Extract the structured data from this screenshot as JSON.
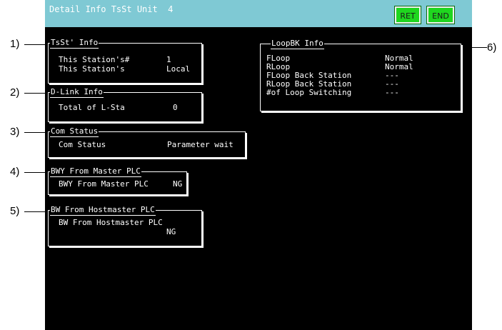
{
  "window": {
    "title": "Detail Info TsSt Unit  4"
  },
  "buttons": {
    "ret": "RET",
    "end": "END"
  },
  "callouts": [
    "1)",
    "2)",
    "3)",
    "4)",
    "5)",
    "6)"
  ],
  "tsst_info": {
    "title": "TsSt' Info",
    "rows": [
      {
        "label": "This Station's#",
        "value": "1"
      },
      {
        "label": "This Station's",
        "value": "Local"
      }
    ]
  },
  "dlink_info": {
    "title": "D-Link Info",
    "rows": [
      {
        "label": "Total of L-Sta",
        "value": "0"
      }
    ]
  },
  "com_status": {
    "title": "Com Status",
    "rows": [
      {
        "label": "Com Status",
        "value": "Parameter wait"
      }
    ]
  },
  "bwy_master": {
    "title": "BWY From Master PLC",
    "rows": [
      {
        "label": "BWY From Master PLC",
        "value": "NG"
      }
    ]
  },
  "bw_hostmaster": {
    "title": "BW From Hostmaster PLC",
    "label": "BW From Hostmaster PLC",
    "value": "NG"
  },
  "loopbk_info": {
    "title": "LoopBK Info",
    "rows": [
      {
        "label": "FLoop",
        "value": "Normal"
      },
      {
        "label": "RLoop",
        "value": "Normal"
      },
      {
        "label": "FLoop Back Station",
        "value": "---"
      },
      {
        "label": "RLoop Back Station",
        "value": "---"
      },
      {
        "label": "#of Loop Switching",
        "value": "---"
      }
    ]
  }
}
